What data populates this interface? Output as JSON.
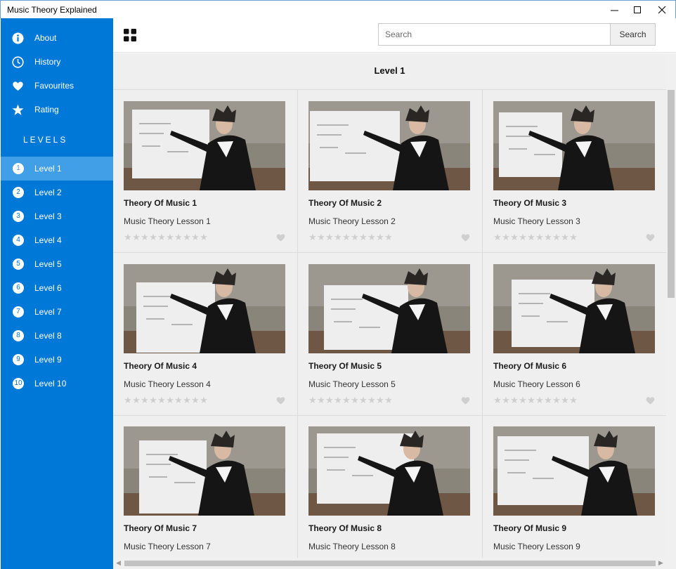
{
  "window": {
    "title": "Music Theory Explained"
  },
  "sidebar": {
    "nav": [
      {
        "label": "About",
        "icon": "info-icon"
      },
      {
        "label": "History",
        "icon": "clock-icon"
      },
      {
        "label": "Favourites",
        "icon": "heart-icon"
      },
      {
        "label": "Rating",
        "icon": "star-icon"
      }
    ],
    "levels_heading": "LEVELS",
    "levels": [
      {
        "num": "1",
        "label": "Level 1",
        "active": true
      },
      {
        "num": "2",
        "label": "Level 2"
      },
      {
        "num": "3",
        "label": "Level 3"
      },
      {
        "num": "4",
        "label": "Level 4"
      },
      {
        "num": "5",
        "label": "Level 5"
      },
      {
        "num": "6",
        "label": "Level 6"
      },
      {
        "num": "7",
        "label": "Level 7"
      },
      {
        "num": "8",
        "label": "Level 8"
      },
      {
        "num": "9",
        "label": "Level 9"
      },
      {
        "num": "10",
        "label": "Level 10"
      }
    ]
  },
  "topbar": {
    "view_icon": "grid-view-icon",
    "search_placeholder": "Search",
    "search_button": "Search"
  },
  "main": {
    "title": "Level 1",
    "videos": [
      {
        "title": "Theory Of Music 1",
        "subtitle": "Music Theory Lesson 1",
        "rating": 0,
        "favourite": false
      },
      {
        "title": "Theory Of Music 2",
        "subtitle": "Music Theory Lesson 2",
        "rating": 0,
        "favourite": false
      },
      {
        "title": "Theory Of Music 3",
        "subtitle": "Music Theory Lesson 3",
        "rating": 0,
        "favourite": false
      },
      {
        "title": "Theory Of Music 4",
        "subtitle": "Music Theory Lesson 4",
        "rating": 0,
        "favourite": false
      },
      {
        "title": "Theory Of Music 5",
        "subtitle": "Music Theory Lesson 5",
        "rating": 0,
        "favourite": false
      },
      {
        "title": "Theory Of Music 6",
        "subtitle": "Music Theory Lesson 6",
        "rating": 0,
        "favourite": false
      },
      {
        "title": "Theory Of Music 7",
        "subtitle": "Music Theory Lesson 7",
        "rating": 0,
        "favourite": false
      },
      {
        "title": "Theory Of Music 8",
        "subtitle": "Music Theory Lesson 8",
        "rating": 0,
        "favourite": false
      },
      {
        "title": "Theory Of Music 9",
        "subtitle": "Music Theory Lesson 9",
        "rating": 0,
        "favourite": false
      }
    ],
    "stars_per_video": 10
  },
  "colors": {
    "accent": "#0078d7",
    "active_item": "#409fe6",
    "content_bg": "#efefef",
    "star_empty": "#cfcfcf"
  }
}
